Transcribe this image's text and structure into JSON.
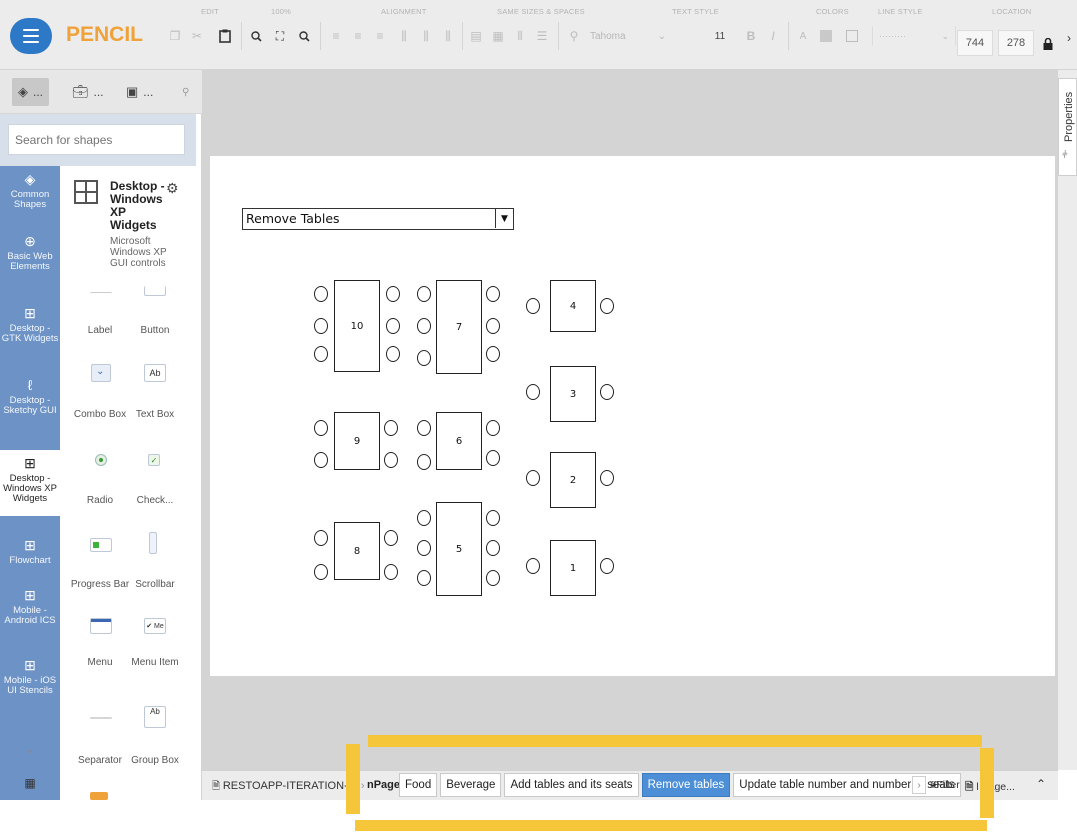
{
  "toolbar": {
    "app_name": "PENCIL",
    "groups": [
      "EDIT",
      "100%",
      "ALIGNMENT",
      "SAME SIZES & SPACES",
      "TEXT STYLE",
      "COLORS",
      "LINE STYLE",
      "LOCATION"
    ],
    "font_family": "Tahoma",
    "font_size": "11",
    "bold": "B",
    "italic": "I",
    "text_color": "A",
    "location_x": "744",
    "location_y": "278"
  },
  "left_panel": {
    "tabs": [
      "...",
      "...",
      "..."
    ],
    "search_placeholder": "Search for shapes",
    "categories": [
      {
        "label": "Common Shapes",
        "icon": "layers-icon"
      },
      {
        "label": "Basic Web Elements",
        "icon": "globe-icon"
      },
      {
        "label": "Desktop - GTK Widgets",
        "icon": "grid-icon"
      },
      {
        "label": "Desktop - Sketchy GUI",
        "icon": "sketch-icon"
      },
      {
        "label": "Desktop - Windows XP Widgets",
        "icon": "grid-icon"
      },
      {
        "label": "Flowchart",
        "icon": "grid-icon"
      },
      {
        "label": "Mobile - Android ICS",
        "icon": "grid-icon"
      },
      {
        "label": "Mobile - iOS UI Stencils",
        "icon": "grid-icon"
      }
    ],
    "library": {
      "title": "Desktop - Windows XP Widgets",
      "description": "Microsoft Windows XP GUI controls"
    },
    "shapes": [
      {
        "label": "Label"
      },
      {
        "label": "Button"
      },
      {
        "label": "Combo Box"
      },
      {
        "label": "Text Box"
      },
      {
        "label": "Radio"
      },
      {
        "label": "Check..."
      },
      {
        "label": "Progress Bar"
      },
      {
        "label": "Scrollbar"
      },
      {
        "label": "Menu"
      },
      {
        "label": "Menu Item"
      },
      {
        "label": "Separator"
      },
      {
        "label": "Group Box"
      }
    ],
    "thumb_texts": {
      "textbox": "Ab",
      "menuitem": "✔ Me",
      "groupbox": "Ab"
    }
  },
  "canvas": {
    "dropdown_value": "Remove Tables",
    "tables": [
      {
        "number": "10"
      },
      {
        "number": "7"
      },
      {
        "number": "4"
      },
      {
        "number": "3"
      },
      {
        "number": "9"
      },
      {
        "number": "6"
      },
      {
        "number": "2"
      },
      {
        "number": "8"
      },
      {
        "number": "5"
      },
      {
        "number": "1"
      }
    ]
  },
  "right_panel": {
    "properties_label": "Properties"
  },
  "bottom_bar": {
    "document_name": "RESTOAPP-ITERATION-2",
    "breadcrumb_sep": "›",
    "current_page_partial": "nPage",
    "page_tabs": [
      {
        "label": "Food",
        "active": false
      },
      {
        "label": "Beverage",
        "active": false
      },
      {
        "label": "Add tables and its seats",
        "active": false
      },
      {
        "label": "Remove tables",
        "active": true
      },
      {
        "label": "Update table number and number of seats",
        "active": false
      }
    ],
    "filter_label": "Filter",
    "pages_label": "l Page..."
  },
  "colors": {
    "brand_orange": "#f0a23a",
    "menu_blue": "#2e79c7",
    "category_blue": "#6d93c6",
    "active_tab": "#4c8fd6",
    "annotation_yellow": "#f5c63a"
  }
}
